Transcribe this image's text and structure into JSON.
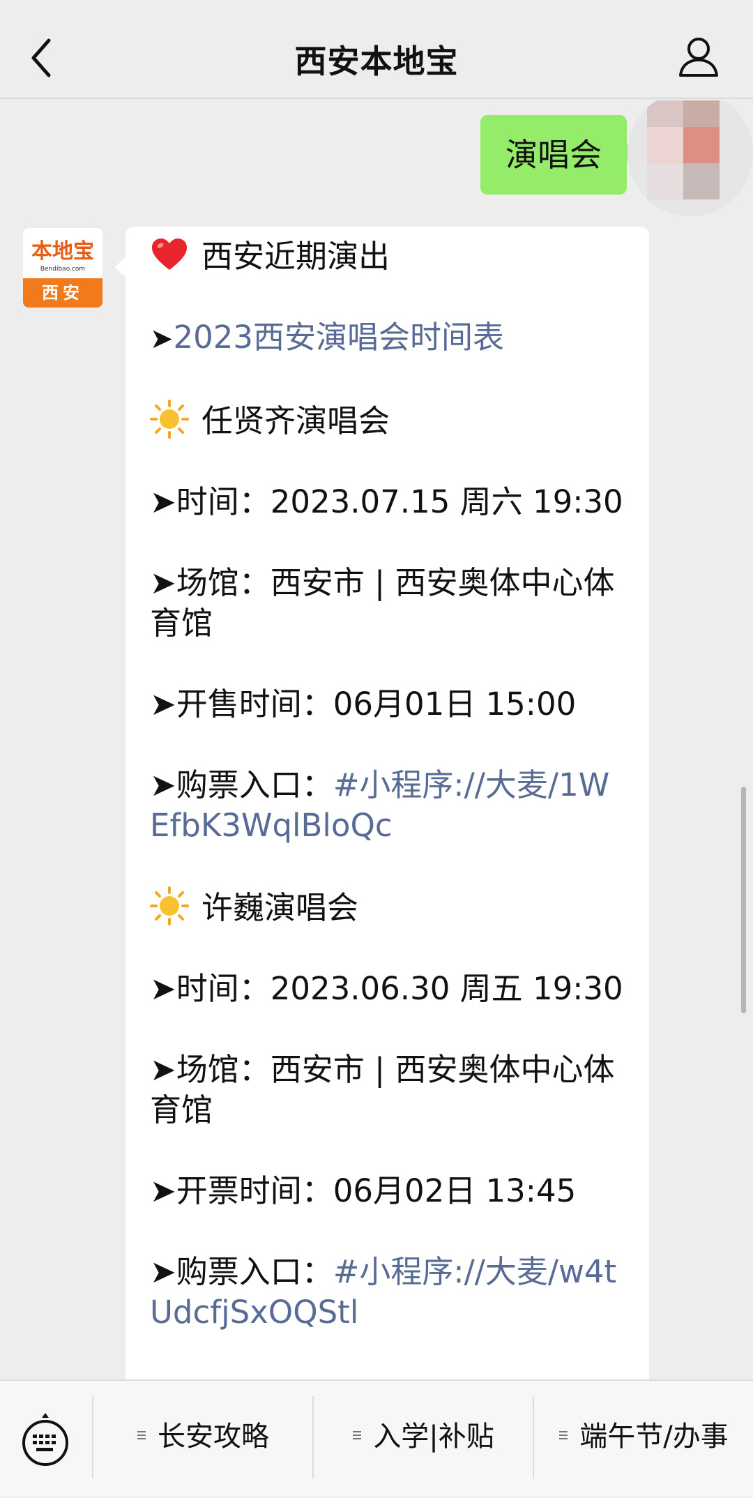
{
  "header": {
    "title": "西安本地宝"
  },
  "outgoing": {
    "text": "演唱会"
  },
  "bot": {
    "logo_title": "本地宝",
    "logo_sub": "Bendibao.com",
    "logo_city": "西安"
  },
  "message": {
    "heading": "西安近期演出",
    "schedule_arrow": "➤",
    "schedule_link": "2023西安演唱会时间表",
    "concert1": {
      "name": "任贤齐演唱会",
      "time": "➤时间：2023.07.15 周六 19:30",
      "venue": "➤场馆：西安市 | 西安奥体中心体育馆",
      "sale": "➤开售时间：06月01日 15:00",
      "ticket_label": "➤购票入口：",
      "ticket_link": "#小程序://大麦/1WEfbK3WqlBloQc"
    },
    "concert2": {
      "name": "许巍演唱会",
      "time": "➤时间：2023.06.30 周五 19:30",
      "venue": "➤场馆：西安市 | 西安奥体中心体育馆",
      "sale": "➤开票时间：06月02日 13:45",
      "ticket_label": "➤购票入口：",
      "ticket_link": "#小程序://大麦/w4tUdcfjSxOQStl"
    }
  },
  "bottom_menu": {
    "items": [
      "长安攻略",
      "入学|补贴",
      "端午节/办事"
    ]
  },
  "colors": {
    "link": "#576b95",
    "outgoing_bubble": "#95ec69",
    "logo_orange": "#f17b1c"
  },
  "icons": [
    "back-arrow-icon",
    "profile-icon",
    "heart-icon",
    "sun-icon",
    "keyboard-icon",
    "menu-list-icon"
  ]
}
